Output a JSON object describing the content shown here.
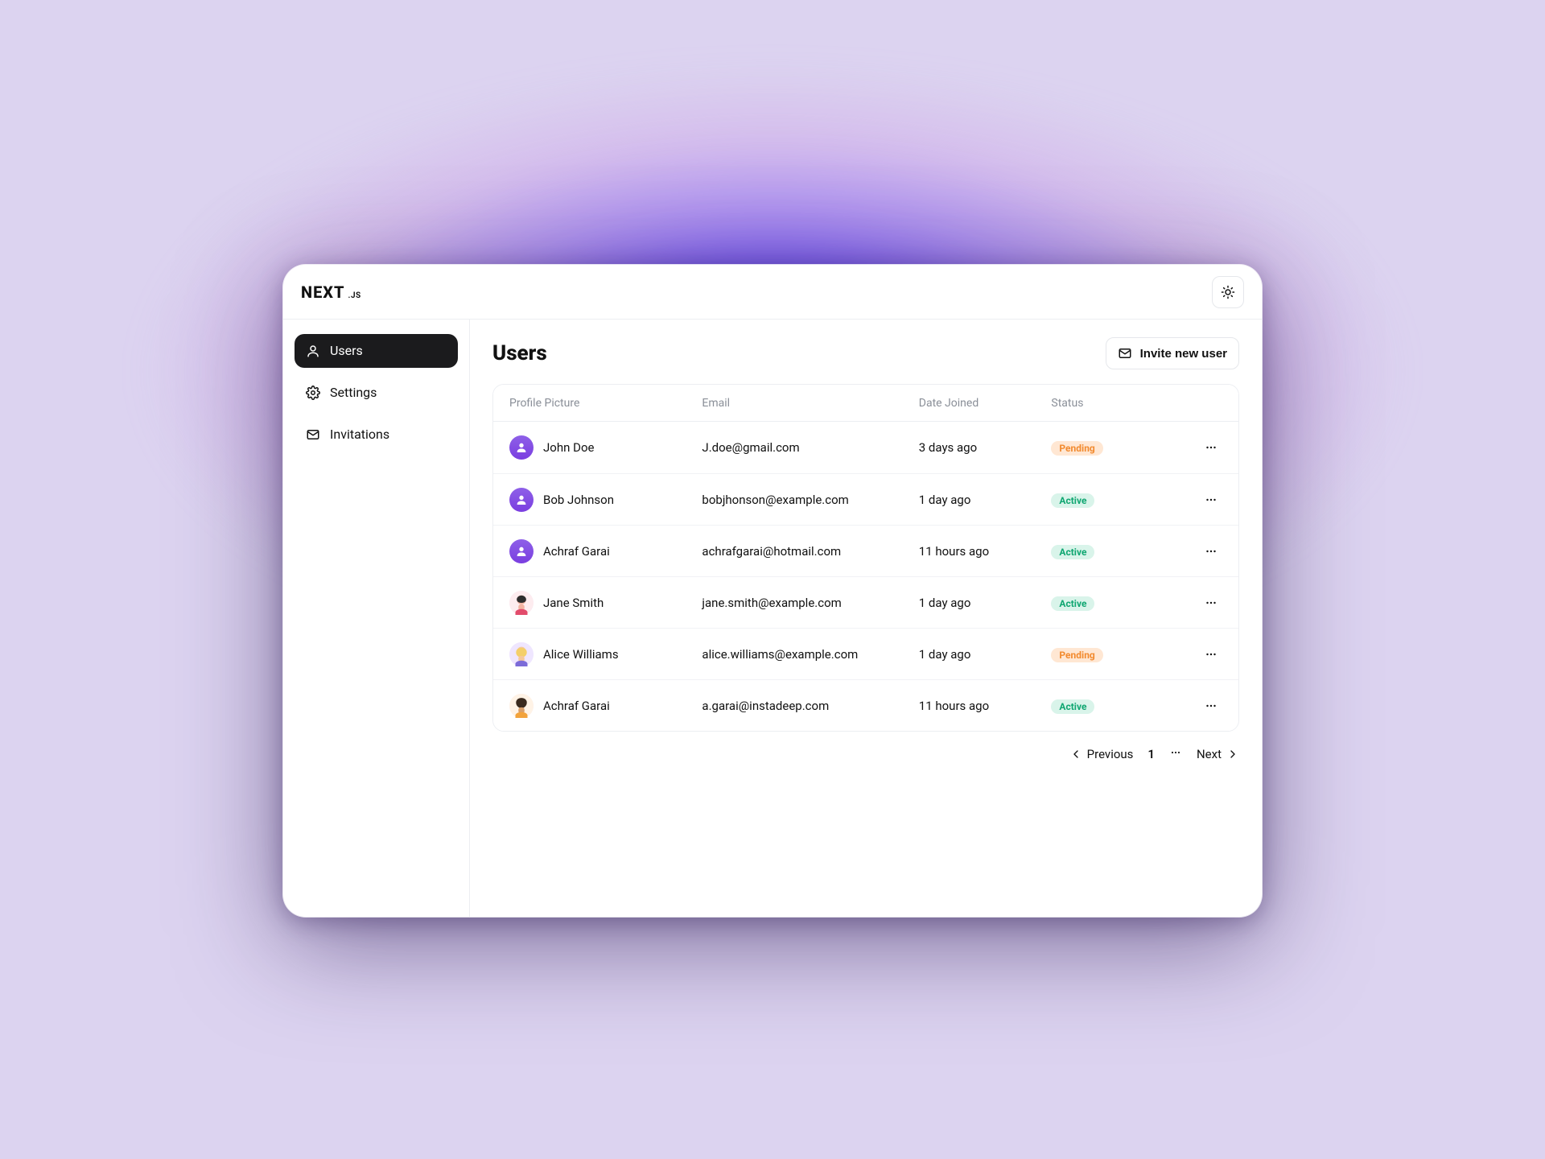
{
  "brand": {
    "name": "NEXT",
    "suffix": ".JS"
  },
  "sidebar": {
    "items": [
      {
        "label": "Users",
        "icon": "user-icon",
        "active": true
      },
      {
        "label": "Settings",
        "icon": "gear-icon",
        "active": false
      },
      {
        "label": "Invitations",
        "icon": "mail-icon",
        "active": false
      }
    ]
  },
  "page": {
    "title": "Users",
    "invite_label": "Invite new user"
  },
  "table": {
    "columns": [
      "Profile Picture",
      "Email",
      "Date Joined",
      "Status"
    ],
    "rows": [
      {
        "name": "John Doe",
        "email": "J.doe@gmail.com",
        "joined": "3 days ago",
        "status": "Pending",
        "avatar": "solid"
      },
      {
        "name": "Bob Johnson",
        "email": "bobjhonson@example.com",
        "joined": "1 day ago",
        "status": "Active",
        "avatar": "solid"
      },
      {
        "name": "Achraf Garai",
        "email": "achrafgarai@hotmail.com",
        "joined": "11 hours ago",
        "status": "Active",
        "avatar": "solid"
      },
      {
        "name": "Jane Smith",
        "email": "jane.smith@example.com",
        "joined": "1 day ago",
        "status": "Active",
        "avatar": "img1"
      },
      {
        "name": "Alice Williams",
        "email": "alice.williams@example.com",
        "joined": "1 day ago",
        "status": "Pending",
        "avatar": "img2"
      },
      {
        "name": "Achraf Garai",
        "email": "a.garai@instadeep.com",
        "joined": "11 hours ago",
        "status": "Active",
        "avatar": "img3"
      }
    ]
  },
  "pagination": {
    "previous": "Previous",
    "next": "Next",
    "page": "1"
  }
}
